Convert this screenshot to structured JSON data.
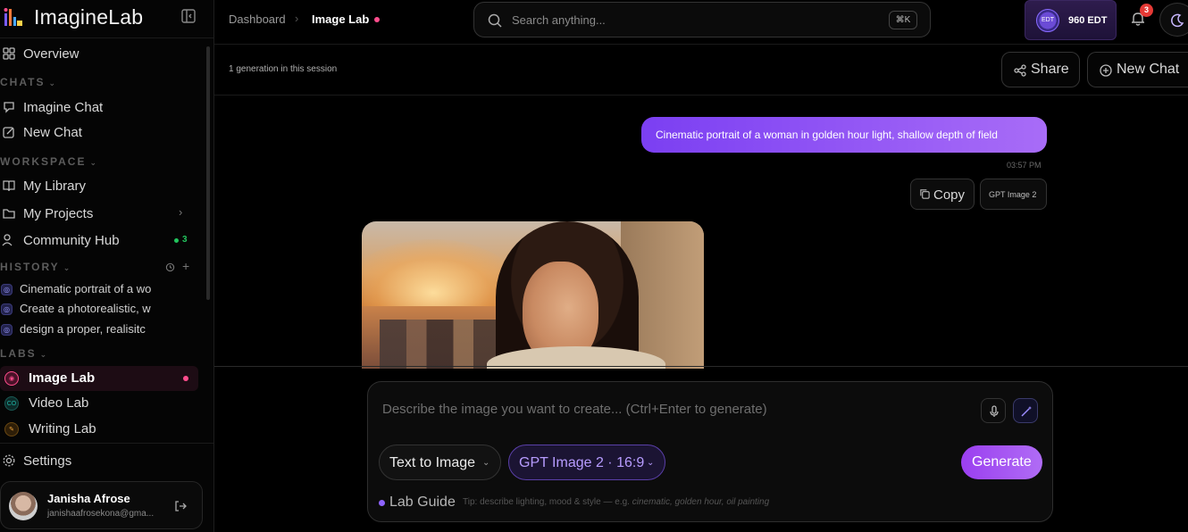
{
  "brand": {
    "name": "ImagineLab"
  },
  "sidebar": {
    "overview": "Overview",
    "sections": {
      "chats": "CHATS",
      "workspace": "WORKSPACE",
      "history": "HISTORY",
      "labs": "LABS"
    },
    "chats": [
      "Imagine Chat",
      "New Chat"
    ],
    "workspace": {
      "library": "My Library",
      "projects": "My Projects",
      "community": "Community Hub",
      "community_count": "3"
    },
    "history": [
      "Cinematic portrait of a wo",
      "Create a photorealistic, w",
      "design a proper, realisitc"
    ],
    "labs": [
      {
        "label": "Image Lab",
        "badge_text": "",
        "color": "#ff4d8d"
      },
      {
        "label": "Video Lab",
        "badge_text": "CO",
        "color": "#1fb5a5"
      },
      {
        "label": "Writing Lab",
        "badge_text": "",
        "color": "#f0a33a"
      }
    ],
    "settings": "Settings",
    "user": {
      "name": "Janisha Afrose",
      "email": "janishaafrosekona@gma..."
    }
  },
  "header": {
    "breadcrumb": [
      "Dashboard",
      "Image Lab"
    ],
    "search_placeholder": "Search anything...",
    "search_shortcut": "⌘K",
    "credits_icon": "EDT",
    "credits": "960 EDT",
    "notification_count": "3"
  },
  "session": {
    "info": "1 generation in this session",
    "share": "Share",
    "new_chat": "New Chat"
  },
  "chat": {
    "prompt": "Cinematic portrait of a woman in golden hour light, shallow depth of field",
    "time": "03:57 PM",
    "copy": "Copy",
    "model": "GPT Image 2"
  },
  "composer": {
    "placeholder": "Describe the image you want to create... (Ctrl+Enter to generate)",
    "mode": "Text to Image",
    "model": "GPT Image 2 · 16:9",
    "generate": "Generate",
    "guide_label": "Lab Guide",
    "guide_tip_prefix": "Tip: describe lighting, mood & style — e.g. ",
    "guide_tip_examples": "cinematic, golden hour, oil painting"
  },
  "colors": {
    "accent": "#9b3ff0",
    "active_dot": "#ff4d8d",
    "online": "#22c55e"
  }
}
